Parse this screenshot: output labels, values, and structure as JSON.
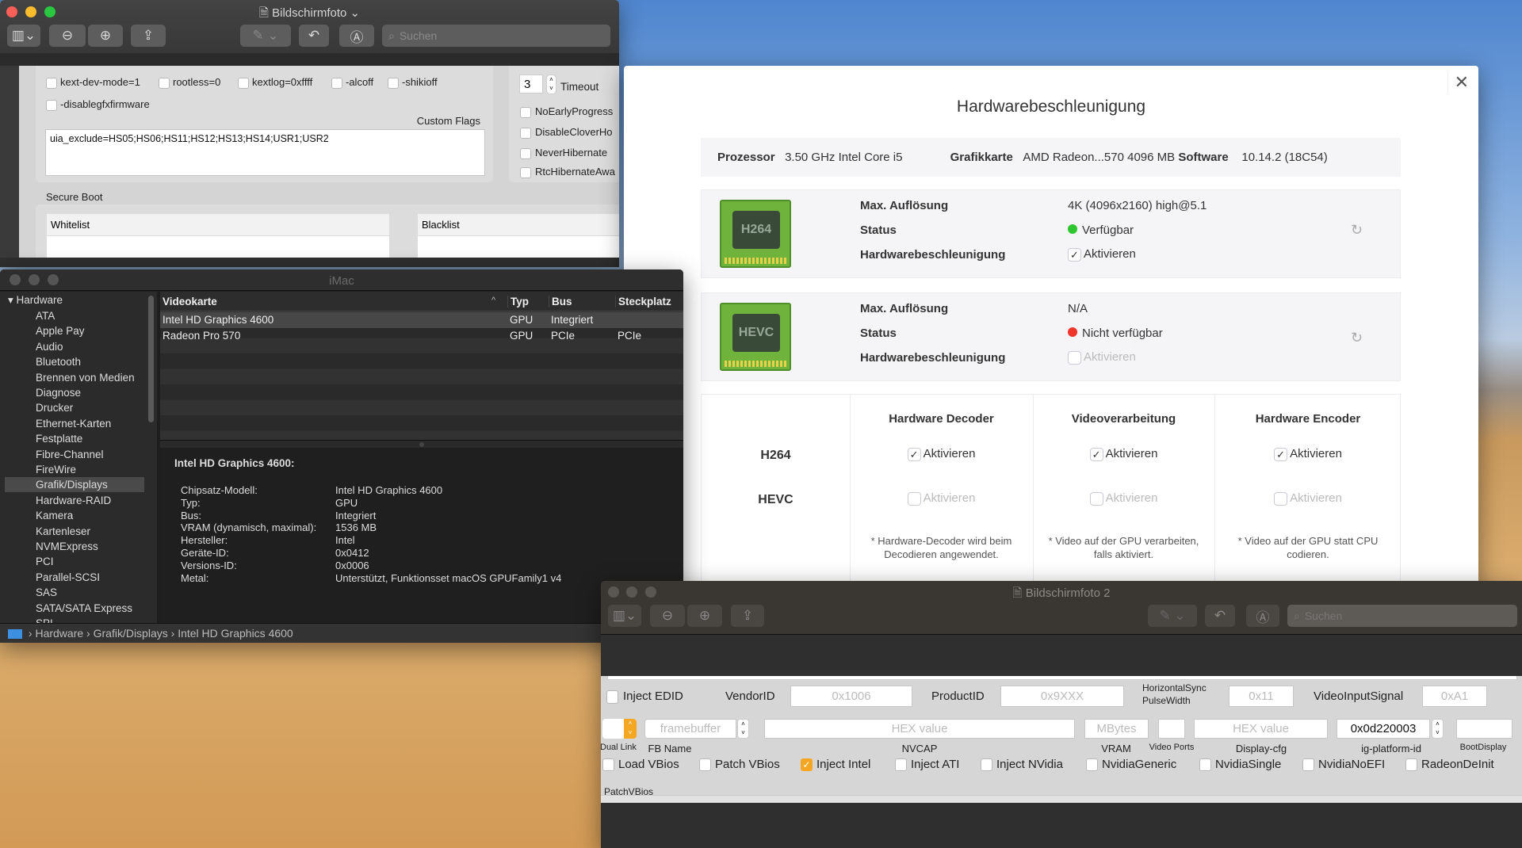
{
  "win1": {
    "title": "Bildschirmfoto",
    "search_placeholder": "Suchen",
    "flags": [
      "kext-dev-mode=1",
      "rootless=0",
      "kextlog=0xffff",
      "-alcoff",
      "-shikioff",
      "-disablegfxfirmware"
    ],
    "custom_flags_label": "Custom Flags",
    "custom_flags_value": "uia_exclude=HS05;HS06;HS11;HS12;HS13;HS14;USR1;USR2",
    "timeout_value": "3",
    "timeout_label": "Timeout",
    "right_flags": [
      "NoEarlyProgress",
      "DisableCloverHo",
      "NeverHibernate",
      "RtcHibernateAwa"
    ],
    "secure_boot_label": "Secure Boot",
    "whitelist_label": "Whitelist",
    "blacklist_label": "Blacklist"
  },
  "imac": {
    "title": "iMac",
    "sidebar_header": "Hardware",
    "sidebar_items": [
      "ATA",
      "Apple Pay",
      "Audio",
      "Bluetooth",
      "Brennen von Medien",
      "Diagnose",
      "Drucker",
      "Ethernet-Karten",
      "Festplatte",
      "Fibre-Channel",
      "FireWire",
      "Grafik/Displays",
      "Hardware-RAID",
      "Kamera",
      "Kartenleser",
      "NVMExpress",
      "PCI",
      "Parallel-SCSI",
      "SAS",
      "SATA/SATA Express",
      "SPI"
    ],
    "selected_index": 11,
    "columns": [
      "Videokarte",
      "Typ",
      "Bus",
      "Steckplatz"
    ],
    "rows": [
      [
        "Intel HD Graphics 4600",
        "GPU",
        "Integriert",
        ""
      ],
      [
        "Radeon Pro 570",
        "GPU",
        "PCIe",
        "PCIe"
      ]
    ],
    "detail_title": "Intel HD Graphics 4600:",
    "details": [
      [
        "Chipsatz-Modell:",
        "Intel HD Graphics 4600"
      ],
      [
        "Typ:",
        "GPU"
      ],
      [
        "Bus:",
        "Integriert"
      ],
      [
        "VRAM (dynamisch, maximal):",
        "1536 MB"
      ],
      [
        "Hersteller:",
        "Intel"
      ],
      [
        "Geräte-ID:",
        "0x0412"
      ],
      [
        "Versions-ID:",
        "0x0006"
      ],
      [
        "Metal:",
        "Unterstützt, Funktionsset macOS GPUFamily1 v4"
      ]
    ],
    "path": [
      "Hardware",
      "Grafik/Displays",
      "Intel HD Graphics 4600"
    ]
  },
  "hw": {
    "title": "Hardwarebeschleunigung",
    "info": {
      "prozessor_label": "Prozessor",
      "prozessor": "3.50 GHz Intel Core i5",
      "grafik_label": "Grafikkarte",
      "grafik": "AMD Radeon...570 4096 MB",
      "software_label": "Software",
      "software": "10.14.2 (18C54)"
    },
    "codecs": [
      {
        "chip": "H264",
        "res_label": "Max. Auflösung",
        "res": "4K (4096x2160) high@5.1",
        "status_label": "Status",
        "status": "Verfügbar",
        "status_color": "#2ec52e",
        "accel_label": "Hardwarebeschleunigung",
        "accel": "Aktivieren",
        "checked": true
      },
      {
        "chip": "HEVC",
        "res_label": "Max. Auflösung",
        "res": "N/A",
        "status_label": "Status",
        "status": "Nicht verfügbar",
        "status_color": "#f0352b",
        "accel_label": "Hardwarebeschleunigung",
        "accel": "Aktivieren",
        "checked": false
      }
    ],
    "matrix_headers": [
      "Hardware Decoder",
      "Videoverarbeitung",
      "Hardware Encoder"
    ],
    "matrix_rows": [
      "H264",
      "HEVC"
    ],
    "activate": "Aktivieren",
    "notes": [
      "* Hardware-Decoder wird beim Decodieren angewendet.",
      "* Video auf der GPU verarbeiten, falls aktiviert.",
      "* Video auf der GPU statt CPU codieren."
    ]
  },
  "win2": {
    "title": "Bildschirmfoto 2",
    "search_placeholder": "Suchen",
    "inject_edid": "Inject EDID",
    "vendor_label": "VendorID",
    "vendor": "0x1006",
    "product_label": "ProductID",
    "product": "0x9XXX",
    "hsync_label1": "HorizontalSync",
    "hsync_label2": "PulseWidth",
    "hsync": "0x11",
    "vis_label": "VideoInputSignal",
    "vis": "0xA1",
    "fb_placeholder": "framebuffer",
    "nvcap_placeholder": "HEX value",
    "vram_placeholder": "MBytes",
    "dcfg_placeholder": "HEX value",
    "platform_id": "0x0d220003",
    "labels": {
      "dual": "Dual Link",
      "fb": "FB Name",
      "nvcap": "NVCAP",
      "vram": "VRAM",
      "ports": "Video Ports",
      "dcfg": "Display-cfg",
      "igp": "ig-platform-id",
      "boot": "BootDisplay"
    },
    "checks": [
      {
        "label": "Load VBios",
        "checked": false
      },
      {
        "label": "Patch VBios",
        "checked": false
      },
      {
        "label": "Inject Intel",
        "checked": true
      },
      {
        "label": "Inject ATI",
        "checked": false
      },
      {
        "label": "Inject NVidia",
        "checked": false
      },
      {
        "label": "NvidiaGeneric",
        "checked": false
      },
      {
        "label": "NvidiaSingle",
        "checked": false
      },
      {
        "label": "NvidiaNoEFI",
        "checked": false
      },
      {
        "label": "RadeonDeInit",
        "checked": false
      }
    ],
    "patch_vbios_label": "PatchVBios"
  },
  "colors": {
    "accent": "#f5a623",
    "selected": "#4a4a4a"
  }
}
